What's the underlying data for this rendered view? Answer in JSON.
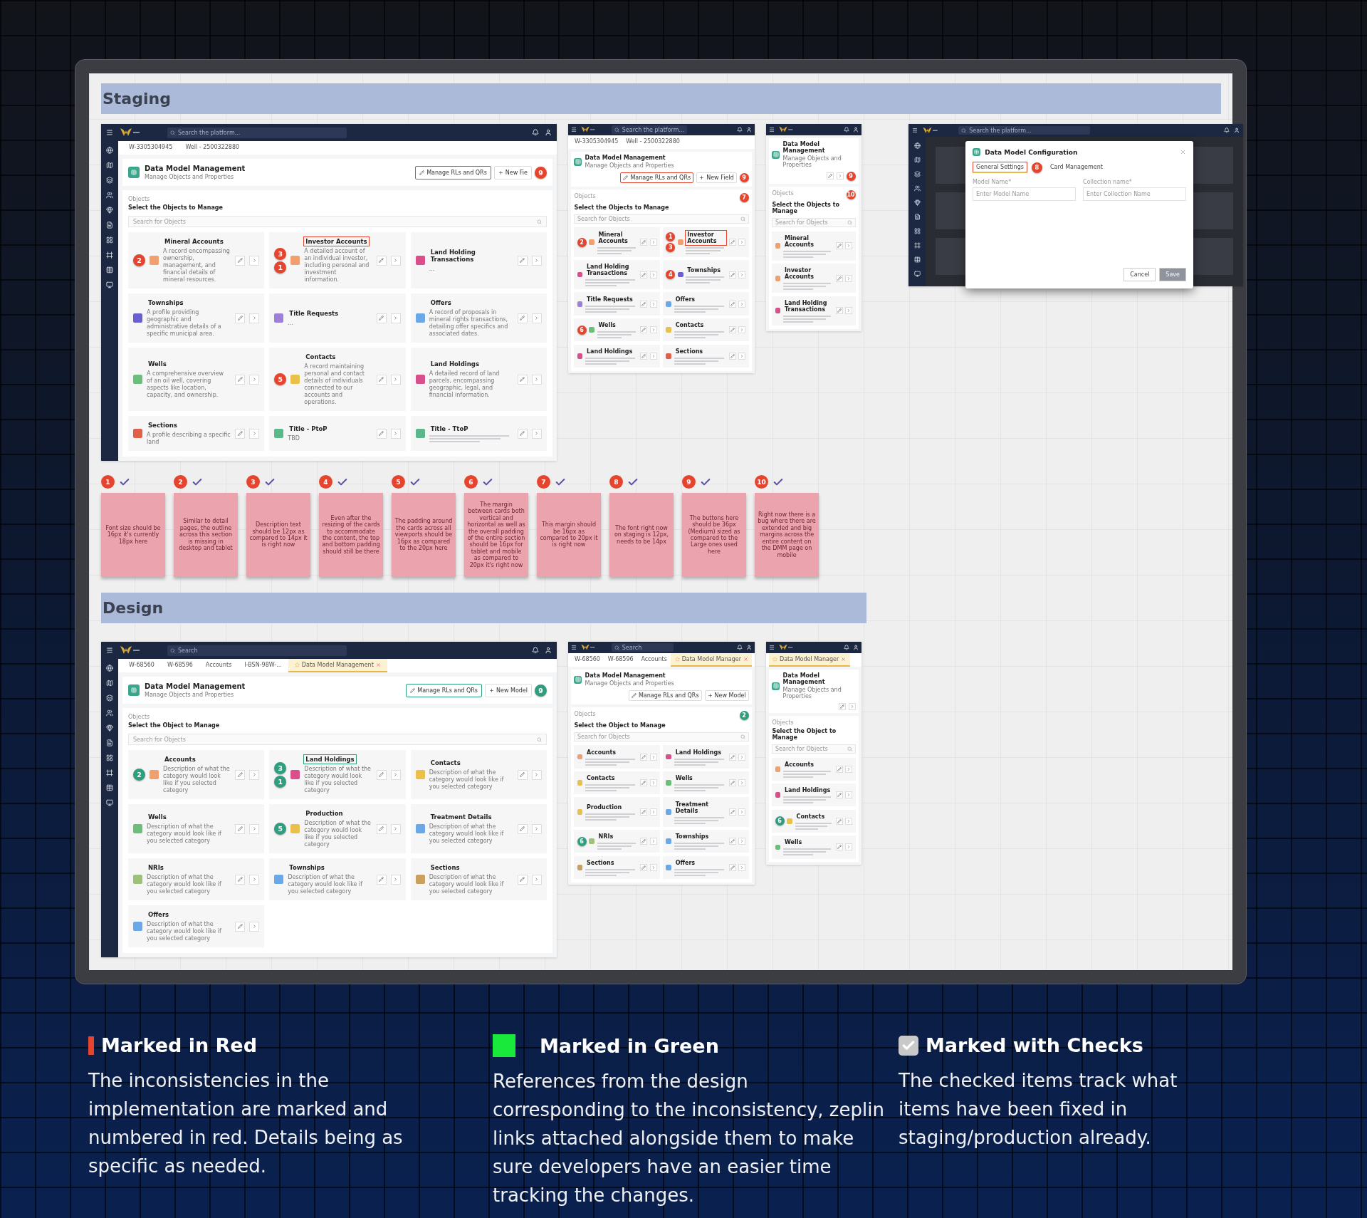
{
  "sections": [
    {
      "title": "Staging",
      "color": "#e5452e",
      "screens": [
        {
          "kind": "desktop",
          "search": "Search the platform...",
          "tabs": [
            {
              "label": "W-3305304945",
              "selected": false
            },
            {
              "label": "Well - 2500322880",
              "selected": false
            }
          ],
          "title": "Data Model Management",
          "subtitle": "Manage Objects and Properties",
          "actions": [
            {
              "label": "Manage RLs and QRs",
              "outlined": true
            },
            {
              "label": "New Fie",
              "outlined": false
            }
          ],
          "action_marker": "9",
          "objects_label": "Objects",
          "objects_title": "Select the Objects to Manage",
          "objects_search": "Search for Objects",
          "cards": [
            {
              "title": "Mineral Accounts",
              "text": "A record encompassing ownership, management, and financial details of mineral resources.",
              "color": "#f0a070",
              "outlined": false,
              "markers": [
                "2"
              ]
            },
            {
              "title": "Investor Accounts",
              "text": "A detailed account of an individual investor, including personal and investment information.",
              "color": "#f0a070",
              "outlined": true,
              "markers": [
                "3",
                "1"
              ]
            },
            {
              "title": "Land Holding Transactions",
              "text": "...",
              "color": "#d94f8c",
              "outlined": false
            },
            {
              "title": "Townships",
              "text": "A profile providing geographic and administrative details of a specific municipal area.",
              "color": "#6a5fd0",
              "outlined": false
            },
            {
              "title": "Title Requests",
              "text": "...",
              "color": "#9b7fd8",
              "outlined": false
            },
            {
              "title": "Offers",
              "text": "A record of proposals in mineral rights transactions, detailing offer specifics and associated dates.",
              "color": "#6aa8e8",
              "outlined": false
            },
            {
              "title": "Wells",
              "text": "A comprehensive overview of an oil well, covering aspects like location, capacity, and ownership.",
              "color": "#6cbf7a",
              "outlined": false
            },
            {
              "title": "Contacts",
              "text": "A record maintaining personal and contact details of individuals connected to our accounts and operations.",
              "color": "#e8c04a",
              "outlined": false,
              "markers": [
                "5"
              ]
            },
            {
              "title": "Land Holdings",
              "text": "A detailed record of land parcels, encompassing geographic, legal, and financial information.",
              "color": "#d94f8c",
              "outlined": false
            },
            {
              "title": "Sections",
              "text": "A profile describing a specific land",
              "color": "#e0604a",
              "outlined": false
            },
            {
              "title": "Title - PtoP",
              "text": "TBD",
              "color": "#5cb88a",
              "outlined": false
            },
            {
              "title": "Title - TtoP",
              "color": "#5cb88a",
              "outlined": false
            }
          ]
        },
        {
          "kind": "tablet",
          "search": "Search the platform...",
          "tabs": [
            {
              "label": "W-3305304945",
              "selected": false
            },
            {
              "label": "Well - 2500322880",
              "selected": false
            }
          ],
          "title": "Data Model Management",
          "subtitle": "Manage Objects and Properties",
          "actions": [
            {
              "label": "Manage RLs and QRs",
              "outlined": true
            },
            {
              "label": "New Field",
              "outlined": false
            }
          ],
          "action_marker": "9",
          "objects_label": "Objects",
          "objects_title": "Select the Objects to Manage",
          "objects_search": "Search for Objects",
          "objects_marker": "7",
          "cards": [
            {
              "title": "Mineral Accounts",
              "color": "#f0a070",
              "outlined": false,
              "markers": [
                "2"
              ]
            },
            {
              "title": "Investor Accounts",
              "color": "#f0a070",
              "outlined": true,
              "markers": [
                "1",
                "3"
              ]
            },
            {
              "title": "Land Holding Transactions",
              "color": "#d94f8c",
              "outlined": false
            },
            {
              "title": "Townships",
              "color": "#6a5fd0",
              "outlined": false,
              "markers": [
                "4"
              ]
            },
            {
              "title": "Title Requests",
              "color": "#9b7fd8",
              "outlined": false
            },
            {
              "title": "Offers",
              "color": "#6aa8e8",
              "outlined": false
            },
            {
              "title": "Wells",
              "color": "#6cbf7a",
              "outlined": false,
              "markers": [
                "6"
              ]
            },
            {
              "title": "Contacts",
              "color": "#e8c04a",
              "outlined": false
            },
            {
              "title": "Land Holdings",
              "color": "#d94f8c",
              "outlined": false
            },
            {
              "title": "Sections",
              "color": "#e0604a",
              "outlined": false
            }
          ]
        },
        {
          "kind": "mobile",
          "title": "Data Model Management",
          "subtitle": "Manage Objects and Properties",
          "action_marker": "9",
          "objects_label": "Objects",
          "objects_title": "Select the Objects to Manage",
          "objects_search": "Search for Objects",
          "objects_marker": "10",
          "cards": [
            {
              "title": "Mineral Accounts",
              "color": "#f0a070",
              "outlined": false
            },
            {
              "title": "Investor Accounts",
              "color": "#f0a070",
              "outlined": false
            },
            {
              "title": "Land Holding Transactions",
              "color": "#d94f8c",
              "outlined": false
            }
          ]
        },
        {
          "kind": "modal",
          "search": "Search the platform...",
          "modal": {
            "title": "Data Model Configuration",
            "tabs": [
              {
                "label": "General Settings",
                "selected": true,
                "marker": "8"
              },
              {
                "label": "Card Management",
                "selected": false
              }
            ],
            "fields": [
              {
                "label": "Model Name*",
                "placeholder": "Enter Model Name"
              },
              {
                "label": "Collection name*",
                "placeholder": "Enter Collection Name"
              }
            ],
            "buttons": [
              "Cancel",
              "Save"
            ]
          }
        }
      ],
      "notes": [
        {
          "number": "1",
          "checked": true,
          "text": "Font size should be 16px it's currently 18px here"
        },
        {
          "number": "2",
          "checked": true,
          "text": "Similar to detail pages, the outline across this section is missing in desktop and tablet"
        },
        {
          "number": "3",
          "checked": true,
          "text": "Description text should be 12px as compared to 14px it is right now"
        },
        {
          "number": "4",
          "checked": true,
          "text": "Even after the resizing of the cards to accommodate the content, the top and bottom padding should still be there"
        },
        {
          "number": "5",
          "checked": true,
          "text": "The padding around the cards across all viewports should be 16px as compared to the 20px here"
        },
        {
          "number": "6",
          "checked": true,
          "text": "The margin between cards both vertical and horizontal as well as the overall padding of the entire section should be 16px for tablet and mobile as compared to 20px it's right now"
        },
        {
          "number": "7",
          "checked": true,
          "text": "This margin should be 16px as compared to 20px it is right now"
        },
        {
          "number": "8",
          "checked": true,
          "text": "The font right now on staging is 12px, needs to be 14px"
        },
        {
          "number": "9",
          "checked": true,
          "text": "The buttons here should be 36px (Medium) sized as compared to the Large ones used here"
        },
        {
          "number": "10",
          "checked": true,
          "text": "Right now there is a bug where there are extended and big margins across the entire content on the DMM page on mobile"
        }
      ]
    },
    {
      "title": "Design",
      "color": "#2f9e7e",
      "screens": [
        {
          "kind": "desktop",
          "search": "Search",
          "tabs": [
            {
              "label": "W-68560",
              "selected": false
            },
            {
              "label": "W-68596",
              "selected": false
            },
            {
              "label": "Accounts",
              "selected": false
            },
            {
              "label": "I-BSN-98W-...",
              "selected": false
            },
            {
              "label": "Data Model Management",
              "selected": true
            }
          ],
          "title": "Data Model Management",
          "subtitle": "Manage Objects and Properties",
          "actions": [
            {
              "label": "Manage RLs and QRs",
              "outlined": true
            },
            {
              "label": "New Model",
              "outlined": false
            }
          ],
          "action_marker": "9",
          "objects_label": "Objects",
          "objects_title": "Select the Object to Manage",
          "objects_search": "Search for Objects",
          "cards": [
            {
              "title": "Accounts",
              "text": "Description of what the category would look like if you selected category",
              "color": "#f0a070",
              "outlined": false,
              "markers": [
                "2"
              ]
            },
            {
              "title": "Land Holdings",
              "text": "Description of what the category would look like if you selected category",
              "color": "#d94f8c",
              "outlined": true,
              "markers": [
                "3",
                "1"
              ]
            },
            {
              "title": "Contacts",
              "text": "Description of what the category would look like if you selected category",
              "color": "#e8c04a",
              "outlined": false
            },
            {
              "title": "Wells",
              "text": "Description of what the category would look like if you selected category",
              "color": "#6cbf7a",
              "outlined": false
            },
            {
              "title": "Production",
              "text": "Description of what the category would look like if you selected category",
              "color": "#e8c04a",
              "outlined": false,
              "markers": [
                "5"
              ]
            },
            {
              "title": "Treatment Details",
              "text": "Description of what the category would look like if you selected category",
              "color": "#6aa8e8",
              "outlined": false
            },
            {
              "title": "NRIs",
              "text": "Description of what the category would look like if you selected category",
              "color": "#9cc27a",
              "outlined": false
            },
            {
              "title": "Townships",
              "text": "Description of what the category would look like if you selected category",
              "color": "#6aa8e8",
              "outlined": false
            },
            {
              "title": "Sections",
              "text": "Description of what the category would look like if you selected category",
              "color": "#c9a060",
              "outlined": false
            },
            {
              "title": "Offers",
              "text": "Description of what the category would look like if you selected category",
              "color": "#6aa8e8",
              "outlined": false
            }
          ]
        },
        {
          "kind": "tablet",
          "search": "Search",
          "tabs": [
            {
              "label": "W-68560",
              "selected": false
            },
            {
              "label": "W-68596",
              "selected": false
            },
            {
              "label": "Accounts",
              "selected": false
            },
            {
              "label": "Data Model Manager",
              "selected": true
            }
          ],
          "title": "Data Model Management",
          "subtitle": "Manage Objects and Properties",
          "actions": [
            {
              "label": "Manage RLs and QRs",
              "outlined": false
            },
            {
              "label": "New Model",
              "outlined": false
            }
          ],
          "objects_label": "Objects",
          "objects_title": "Select the Object to Manage",
          "objects_search": "Search for Objects",
          "objects_marker": "2",
          "cards": [
            {
              "title": "Accounts",
              "color": "#f0a070",
              "outlined": false
            },
            {
              "title": "Land Holdings",
              "color": "#d94f8c",
              "outlined": false
            },
            {
              "title": "Contacts",
              "color": "#e8c04a",
              "outlined": false
            },
            {
              "title": "Wells",
              "color": "#6cbf7a",
              "outlined": false
            },
            {
              "title": "Production",
              "color": "#e8c04a",
              "outlined": false
            },
            {
              "title": "Treatment Details",
              "color": "#6aa8e8",
              "outlined": false
            },
            {
              "title": "NRIs",
              "color": "#9cc27a",
              "outlined": false,
              "markers": [
                "6"
              ]
            },
            {
              "title": "Townships",
              "color": "#6aa8e8",
              "outlined": false
            },
            {
              "title": "Sections",
              "color": "#c9a060",
              "outlined": false
            },
            {
              "title": "Offers",
              "color": "#6aa8e8",
              "outlined": false
            }
          ]
        },
        {
          "kind": "mobile",
          "tabs": [
            {
              "label": "Data Model Manager",
              "selected": true
            }
          ],
          "title": "Data Model Management",
          "subtitle": "Manage Objects and Properties",
          "objects_label": "Objects",
          "objects_title": "Select the Object to Manage",
          "objects_search": "Search for Objects",
          "cards": [
            {
              "title": "Accounts",
              "color": "#f0a070",
              "outlined": false
            },
            {
              "title": "Land Holdings",
              "color": "#d94f8c",
              "outlined": false
            },
            {
              "title": "Contacts",
              "color": "#e8c04a",
              "outlined": false,
              "markers": [
                "6"
              ]
            },
            {
              "title": "Wells",
              "color": "#6cbf7a",
              "outlined": false
            }
          ]
        }
      ]
    }
  ],
  "legend": [
    {
      "kind": "bar",
      "title": "Marked in Red",
      "text": "The inconsistencies in the implementation are marked and numbered in red. Details being as specific as needed."
    },
    {
      "kind": "square",
      "title": "Marked in Green",
      "text": "References from the design corresponding to the inconsistency, zeplin links attached alongside them to make sure developers have an easier time tracking the changes."
    },
    {
      "kind": "check",
      "title": "Marked with Checks",
      "text": "The checked items track what items have been fixed in staging/production already."
    }
  ]
}
